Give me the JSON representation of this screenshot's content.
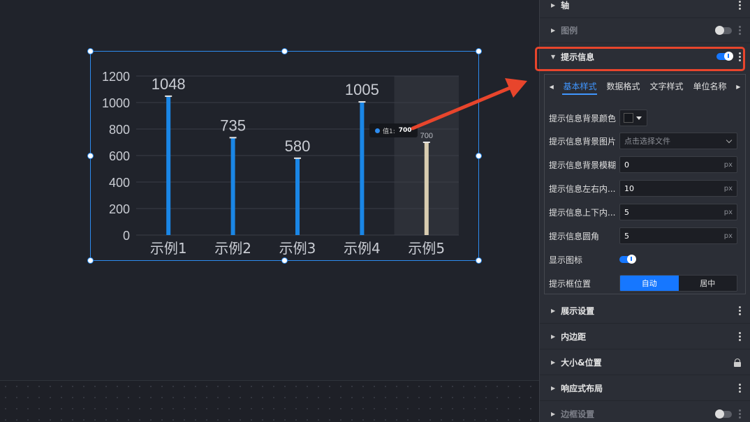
{
  "chart": {
    "y_ticks": [
      "1200",
      "1000",
      "800",
      "600",
      "400",
      "200",
      "0"
    ],
    "tooltip": {
      "series": "值1:",
      "value": "700"
    }
  },
  "chart_data": {
    "type": "bar",
    "categories": [
      "示例1",
      "示例2",
      "示例3",
      "示例4",
      "示例5"
    ],
    "values": [
      1048,
      735,
      580,
      1005,
      700
    ],
    "data_labels": [
      "1048",
      "735",
      "580",
      "1005",
      "700"
    ],
    "ylim": [
      0,
      1200
    ],
    "yticks": [
      0,
      200,
      400,
      600,
      800,
      1000,
      1200
    ],
    "grid": true,
    "highlighted_index": 4,
    "bar_color": "#1a86e6",
    "highlight_bar_color": "#d8ccb0"
  },
  "panel": {
    "axis_label": "轴",
    "legend_label": "图例",
    "tooltip_label": "提示信息",
    "tabs": [
      "基本样式",
      "数据格式",
      "文字样式",
      "单位名称"
    ],
    "fields": {
      "bg_color_label": "提示信息背景颜色",
      "bg_image_label": "提示信息背景图片",
      "bg_image_placeholder": "点击选择文件",
      "bg_blur_label": "提示信息背景模糊",
      "bg_blur_value": "0",
      "pad_lr_label": "提示信息左右内...",
      "pad_lr_value": "10",
      "pad_tb_label": "提示信息上下内...",
      "pad_tb_value": "5",
      "radius_label": "提示信息圆角",
      "radius_value": "5",
      "unit": "px",
      "show_icon_label": "显示图标",
      "position_label": "提示框位置",
      "position_auto": "自动",
      "position_center": "居中"
    },
    "display_label": "展示设置",
    "padding_label": "内边距",
    "size_pos_label": "大小&位置",
    "responsive_label": "响应式布局",
    "border_label": "边框设置"
  },
  "colors": {
    "accent": "#1677ff",
    "highlight": "#e8452c",
    "bar": "#1a86e6"
  }
}
